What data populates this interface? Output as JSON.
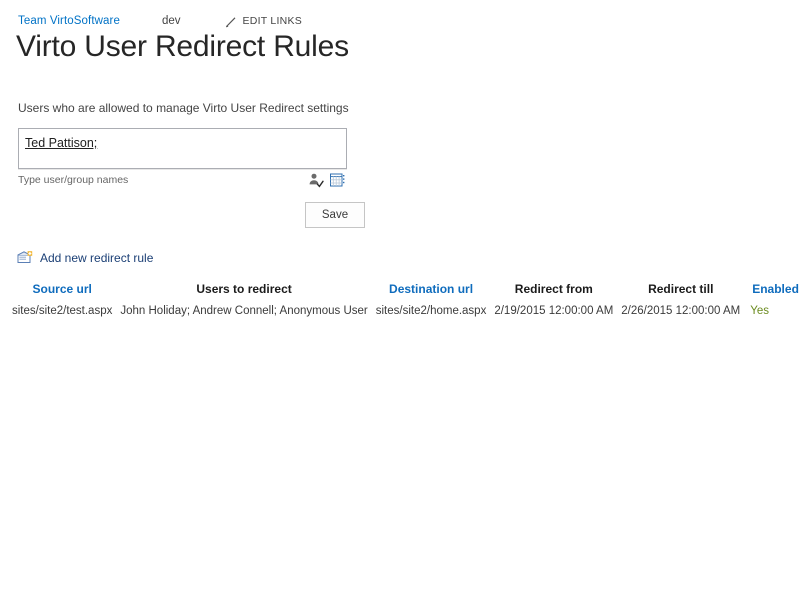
{
  "breadcrumb": {
    "site_link": "Team VirtoSoftware",
    "current": "dev",
    "edit_links": "EDIT LINKS",
    "pencil_icon": "pencil-icon",
    "link_color": "#0072c6"
  },
  "page": {
    "title": "Virto User Redirect Rules"
  },
  "settings": {
    "label": "Users who are allowed to manage Virto User Redirect settings",
    "people_picker": {
      "value": "Ted Pattison;",
      "placeholder": "Type user/group names",
      "hint": "Type user/group names",
      "check_names_icon": "check-names-icon",
      "browse_icon": "address-book-icon"
    },
    "save_label": "Save"
  },
  "actions": {
    "add_new_label": "Add new redirect rule",
    "add_new_icon": "new-item-icon"
  },
  "table": {
    "headers": [
      {
        "label": "Source url",
        "is_link": true
      },
      {
        "label": "Users to redirect",
        "is_link": false
      },
      {
        "label": "Destination url",
        "is_link": true
      },
      {
        "label": "Redirect from",
        "is_link": false
      },
      {
        "label": "Redirect till",
        "is_link": false
      },
      {
        "label": "Enabled",
        "is_link": true
      }
    ],
    "rows": [
      {
        "source_url": "sites/site2/test.aspx",
        "users_to_redirect": "John Holiday; Andrew Connell; Anonymous User",
        "destination_url": "sites/site2/home.aspx",
        "redirect_from": "2/19/2015 12:00:00 AM",
        "redirect_till": "2/26/2015 12:00:00 AM",
        "enabled": "Yes",
        "edit_icon": "edit-icon",
        "delete_icon": "delete-x-icon"
      }
    ],
    "header_link_color": "#0f6cbd",
    "enabled_color": "#6c8c20"
  }
}
